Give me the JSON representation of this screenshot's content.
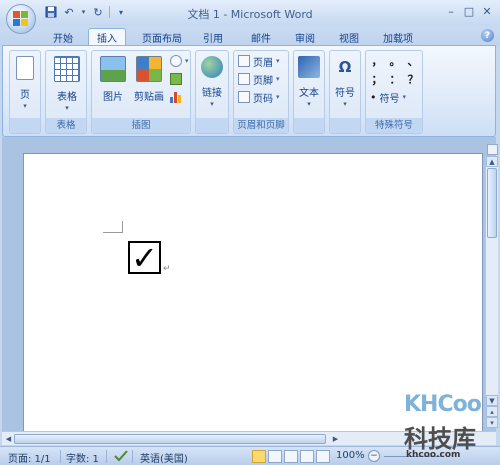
{
  "window": {
    "title": "文档 1 - Microsoft Word",
    "controls": [
      "minimize",
      "maximize",
      "close"
    ]
  },
  "quick_access": {
    "items": [
      "save-icon",
      "undo-icon",
      "dropdown-arrow",
      "redo-icon",
      "customize-icon"
    ]
  },
  "tabs": [
    {
      "label": "开始"
    },
    {
      "label": "插入"
    },
    {
      "label": "页面布局"
    },
    {
      "label": "引用"
    },
    {
      "label": "邮件"
    },
    {
      "label": "审阅"
    },
    {
      "label": "视图"
    },
    {
      "label": "加载项"
    }
  ],
  "ribbon": {
    "page_group": {
      "button_label": "页"
    },
    "table_group": {
      "button_label": "表格",
      "group_label": "表格"
    },
    "illustrations_group": {
      "picture_label": "图片",
      "clipart_label": "剪贴画",
      "group_label": "插图"
    },
    "links_group": {
      "button_label": "链接"
    },
    "header_footer_group": {
      "header_label": "页眉",
      "footer_label": "页脚",
      "page_number_label": "页码",
      "group_label": "页眉和页脚"
    },
    "text_group": {
      "button_label": "文本"
    },
    "symbol_group": {
      "button_label": "符号"
    },
    "special_chars_group": {
      "symbols": [
        "，",
        "。",
        "、",
        "；",
        "：",
        "？"
      ],
      "symbol_button_label": "符号",
      "group_label": "特殊符号"
    }
  },
  "document": {
    "checkbox_glyph": "✓",
    "paragraph_mark": "↵"
  },
  "statusbar": {
    "page": "页面: 1/1",
    "words": "字数: 1",
    "language": "英语(美国)",
    "zoom": "100%"
  },
  "watermark": {
    "logo": "KHCoo",
    "name": "科技库",
    "url": "khcoo.com"
  },
  "colors": {
    "accent": "#15428b",
    "ribbon_bg": "#dfeaf9",
    "active_view": "#fbd870"
  }
}
